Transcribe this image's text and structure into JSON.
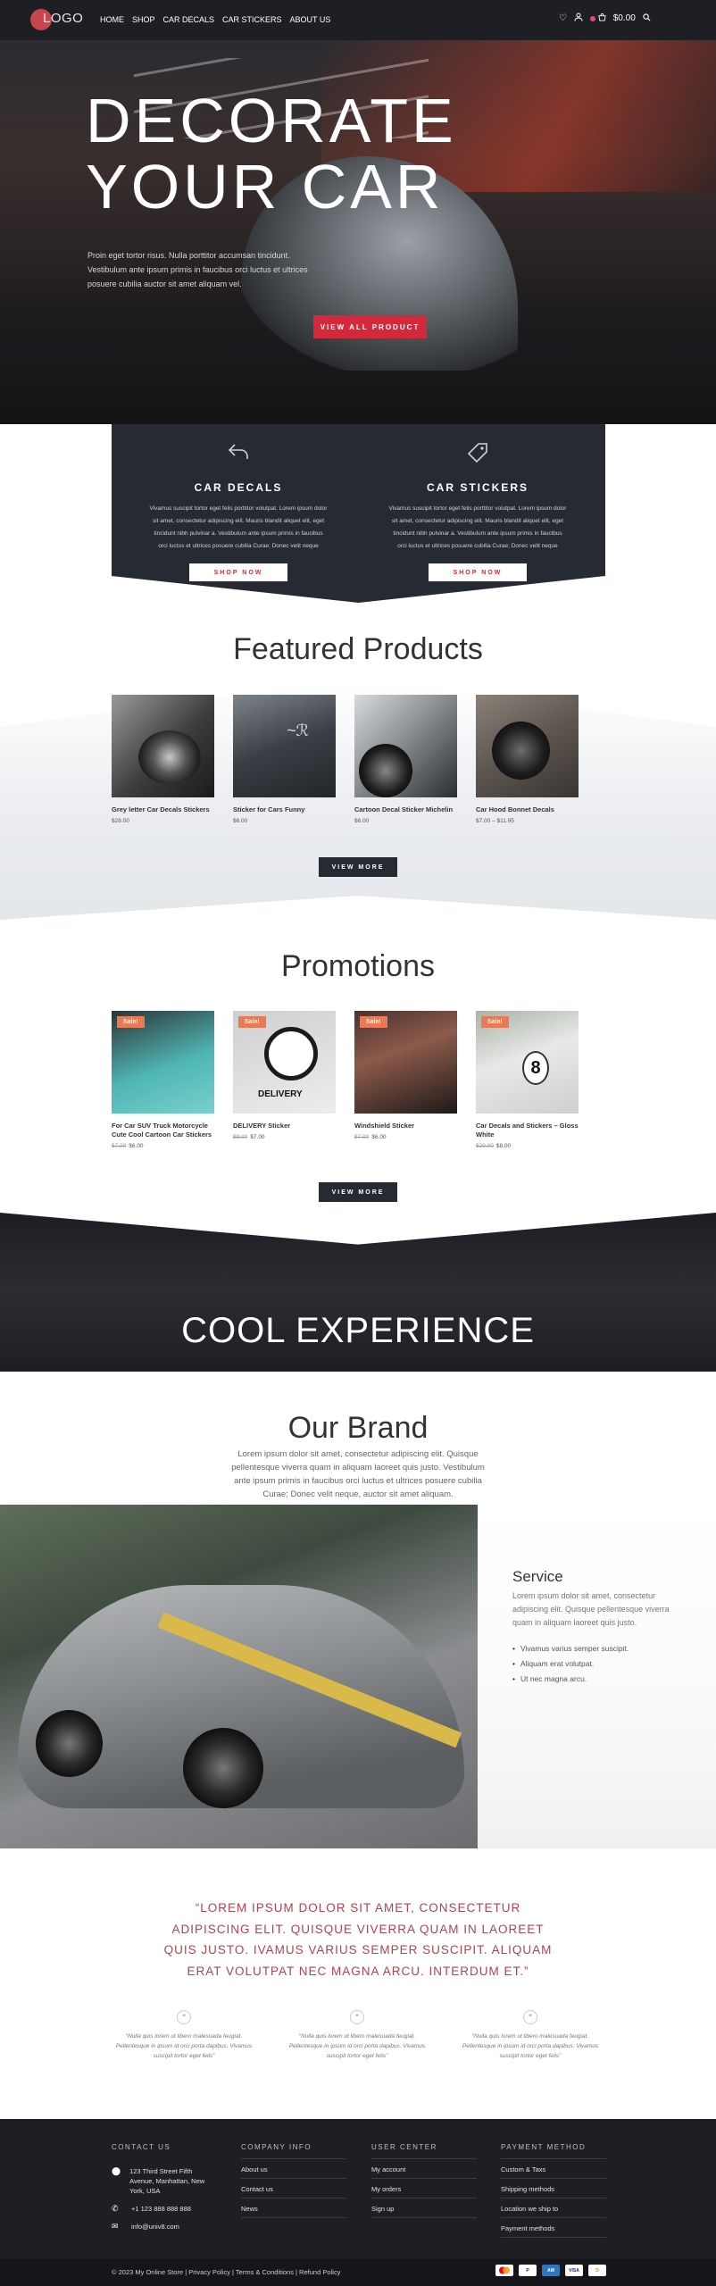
{
  "header": {
    "logo_text": "LOGO",
    "nav": [
      "HOME",
      "SHOP",
      "CAR DECALS",
      "CAR STICKERS",
      "ABOUT US"
    ],
    "cart_total": "$0.00",
    "icons": [
      "heart-icon",
      "user-icon",
      "cart-icon",
      "search-icon"
    ]
  },
  "hero": {
    "title_line1": "DECORATE",
    "title_line2": "YOUR CAR",
    "text": "Proin eget tortor risus. Nulla porttitor accumsan tincidunt. Vestibulum ante ipsum primis in faucibus orci luctus et ultrices posuere cubilia auctor sit amet aliquam vel.",
    "button": "VIEW ALL PRODUCT"
  },
  "categories": [
    {
      "icon": "arrow-back-icon",
      "title": "CAR DECALS",
      "text": "Vivamus suscipit tortor eget felis porttitor volutpat. Lorem ipsum dolor sit amet, consectetur adipiscing elit. Mauris blandit aliquet elit, eget tincidunt nibh pulvinar a. Vestibulum ante ipsum primis in faucibus orci luctus et ultrices posuere cubilia Curae; Donec velit neque",
      "button": "SHOP NOW"
    },
    {
      "icon": "tag-icon",
      "title": "CAR STICKERS",
      "text": "Vivamus suscipit tortor eget felis porttitor volutpat. Lorem ipsum dolor sit amet, consectetur adipiscing elit. Mauris blandit aliquet elit, eget tincidunt nibh pulvinar a. Vestibulum ante ipsum primis in faucibus orci luctus et ultrices posuere cubilia Curae; Donec velit neque",
      "button": "SHOP NOW"
    }
  ],
  "featured": {
    "title": "Featured Products",
    "products": [
      {
        "name": "Grey letter Car Decals Stickers",
        "price": "$28.00"
      },
      {
        "name": "Sticker for Cars Funny",
        "price": "$6.00"
      },
      {
        "name": "Cartoon Decal Sticker Michelin",
        "price": "$6.00"
      },
      {
        "name": "Car Hood Bonnet Decals",
        "price": "$7.00 – $11.95"
      }
    ],
    "button": "VIEW MORE"
  },
  "promotions": {
    "title": "Promotions",
    "sale_label": "Sale!",
    "products": [
      {
        "name": "For Car SUV Truck Motorcycle Cute Cool Cartoon Car Stickers",
        "old_price": "$7.00",
        "price": "$6.00"
      },
      {
        "name": "DELIVERY Sticker",
        "old_price": "$9.00",
        "price": "$7.00"
      },
      {
        "name": "Windshield Sticker",
        "old_price": "$7.00",
        "price": "$6.00"
      },
      {
        "name": "Car Decals and Stickers – Gloss White",
        "old_price": "$29.00",
        "price": "$8.00"
      }
    ],
    "button": "VIEW MORE",
    "delivery_text": "DELIVERY"
  },
  "cool": {
    "title": "COOL EXPERIENCE"
  },
  "brand": {
    "title": "Our Brand",
    "text": "Lorem ipsum dolor sit amet, consectetur adipiscing elit. Quisque pellentesque viverra quam in aliquam laoreet quis justo. Vestibulum ante ipsum primis in faucibus orci luctus et ultrices posuere cubilia Curae; Donec velit neque, auctor sit amet aliquam."
  },
  "service": {
    "title": "Service",
    "text": "Lorem ipsum dolor sit amet, consectetur adipiscing elit. Quisque pellentesque viverra quam in aliquam laoreet quis justo.",
    "list": [
      "Vivamus varius semper suscipit.",
      "Aliquam erat volutpat.",
      "Ut nec magna arcu."
    ]
  },
  "quote": {
    "text": "“LOREM IPSUM DOLOR SIT AMET, CONSECTETUR ADIPISCING ELIT. QUISQUE VIVERRA QUAM IN LAOREET QUIS JUSTO. IVAMUS VARIUS SEMPER SUSCIPIT. ALIQUAM ERAT VOLUTPAT NEC MAGNA ARCU. INTERDUM ET.”",
    "testimonials": [
      "“Nulla quis lorem ut libero malesuada feugiat. Pellentesque in ipsum id orci porta dapibus. Vivamus suscipit tortor eget felis”",
      "“Nulla quis lorem ut libero malesuada feugiat. Pellentesque in ipsum id orci porta dapibus. Vivamus suscipit tortor eget felis”",
      "“Nulla quis lorem ut libero malesuada feugiat. Pellentesque in ipsum id orci porta dapibus. Vivamus suscipit tortor eget felis”"
    ]
  },
  "footer": {
    "contact": {
      "title": "CONTACT US",
      "address": "123 Third Street Fifth Avenue, Manhattan, New York, USA",
      "phone": "+1 123 888 888 888",
      "email": "info@univ8.com"
    },
    "company": {
      "title": "COMPANY INFO",
      "items": [
        "About us",
        "Contact us",
        "News"
      ]
    },
    "user": {
      "title": "USER CENTER",
      "items": [
        "My account",
        "My orders",
        "Sign up"
      ]
    },
    "payment": {
      "title": "PAYMENT METHOD",
      "items": [
        "Custom & Taxs",
        "Shipping methods",
        "Location we ship to",
        "Payment methods"
      ]
    },
    "copyright": "© 2023 My Online Store | Privacy Policy | Terms & Conditions | Refund Policy",
    "payment_icons": [
      "mastercard-icon",
      "paypal-icon",
      "amex-icon",
      "visa-icon",
      "discover-icon"
    ]
  }
}
